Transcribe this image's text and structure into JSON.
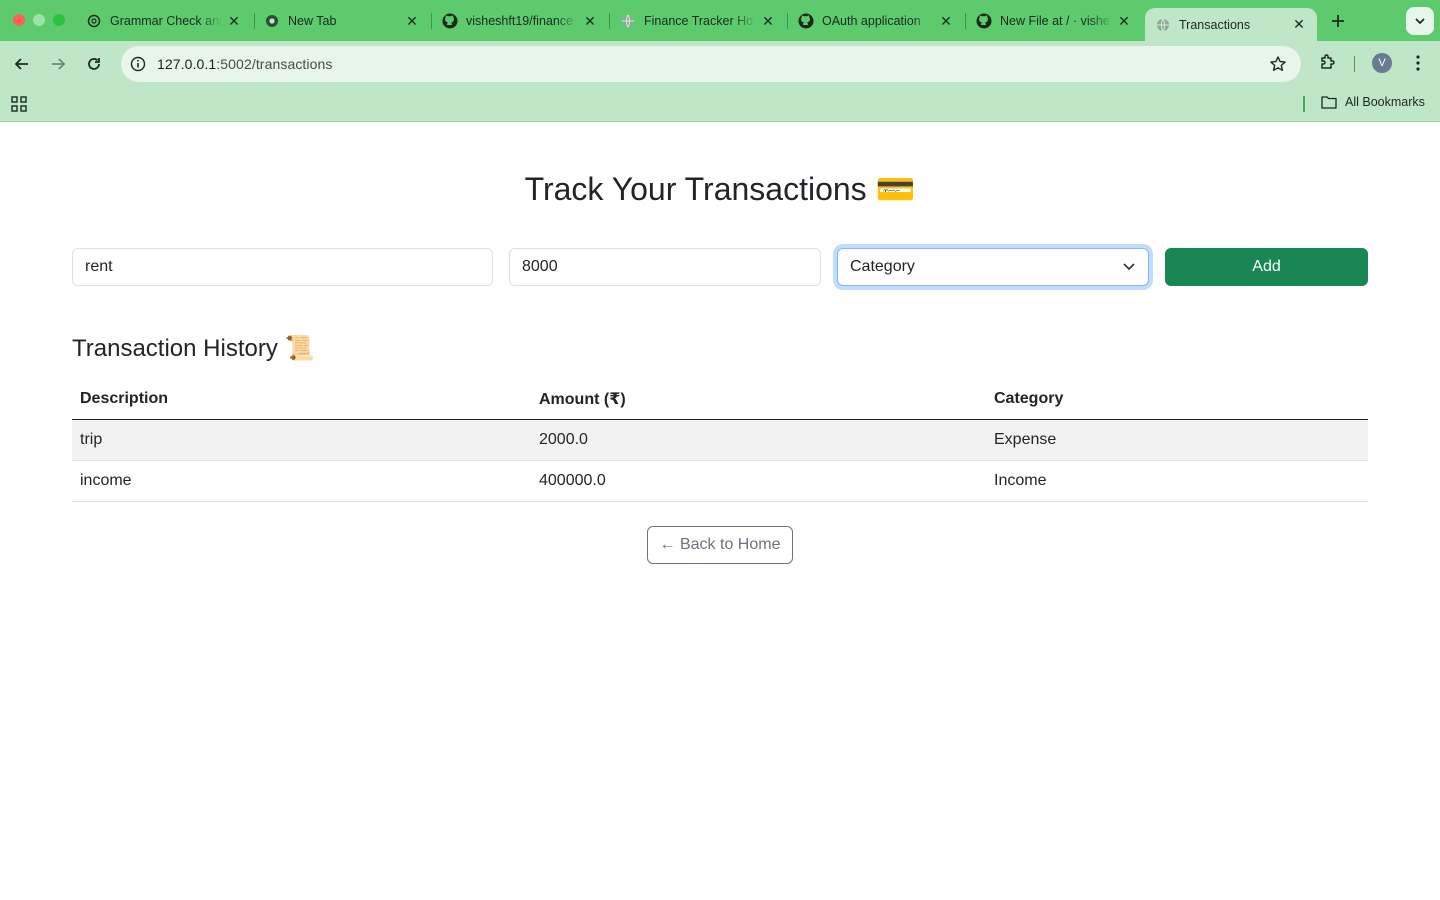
{
  "browser": {
    "tabs": [
      {
        "title": "Grammar Check and",
        "favicon": "openai-icon"
      },
      {
        "title": "New Tab",
        "favicon": "chrome-icon"
      },
      {
        "title": "visheshft19/finance",
        "favicon": "github-icon"
      },
      {
        "title": "Finance Tracker Ho",
        "favicon": "globe-icon"
      },
      {
        "title": "OAuth application",
        "favicon": "github-icon"
      },
      {
        "title": "New File at / · vishe",
        "favicon": "github-icon"
      },
      {
        "title": "Transactions",
        "favicon": "globe-icon",
        "active": true
      }
    ],
    "url_host": "127.0.0.1",
    "url_path": ":5002/transactions",
    "profile_initial": "V",
    "bookmarks_label": "All Bookmarks"
  },
  "page": {
    "title": "Track Your Transactions 💳",
    "form": {
      "description_value": "rent",
      "amount_value": "8000",
      "category_selected": "Category",
      "add_label": "Add"
    },
    "history_title": "Transaction History 📜",
    "table": {
      "headers": [
        "Description",
        "Amount (₹)",
        "Category"
      ],
      "rows": [
        [
          "trip",
          "2000.0",
          "Expense"
        ],
        [
          "income",
          "400000.0",
          "Income"
        ]
      ]
    },
    "back_label": "← Back to Home"
  },
  "colors": {
    "tabstrip": "#5dca6e",
    "toolbar": "#bfe6c7",
    "add_button": "#198754",
    "focus_ring": "#86b7fe"
  }
}
